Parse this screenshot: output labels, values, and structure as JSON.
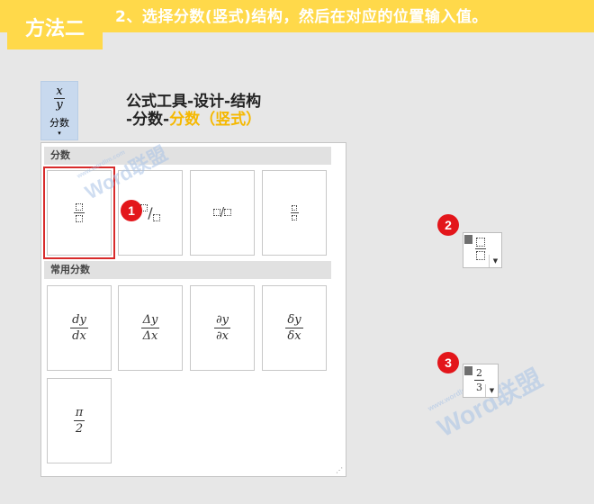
{
  "header": {
    "method_label": "方法二",
    "step_title": "2、选择分数(竖式)结构，然后在对应的位置输入值。"
  },
  "ribbon_button": {
    "x_var": "x",
    "y_var": "y",
    "label": "分数",
    "arrow": "▾"
  },
  "instruction": {
    "line1": "公式工具-设计-结构",
    "line2_prefix": "-分数-",
    "line2_highlight": "分数（竖式）"
  },
  "gallery": {
    "section1": "分数",
    "section2": "常用分数",
    "common": [
      {
        "num": "dy",
        "den": "dx"
      },
      {
        "num": "Δy",
        "den": "Δx"
      },
      {
        "num": "∂y",
        "den": "∂x"
      },
      {
        "num": "δy",
        "den": "δx"
      },
      {
        "num": "π",
        "den": "2"
      }
    ],
    "resize_glyph": "⋰"
  },
  "badges": [
    "1",
    "2",
    "3"
  ],
  "widget3": {
    "num": "2",
    "den": "3"
  },
  "watermark": {
    "text": "Word联盟",
    "url": "www.wordlm.com"
  },
  "colors": {
    "accent_yellow": "#ffd94a",
    "highlight_text": "#f5b800",
    "badge_red": "#e3161b",
    "selection_red": "#d82b2b"
  }
}
